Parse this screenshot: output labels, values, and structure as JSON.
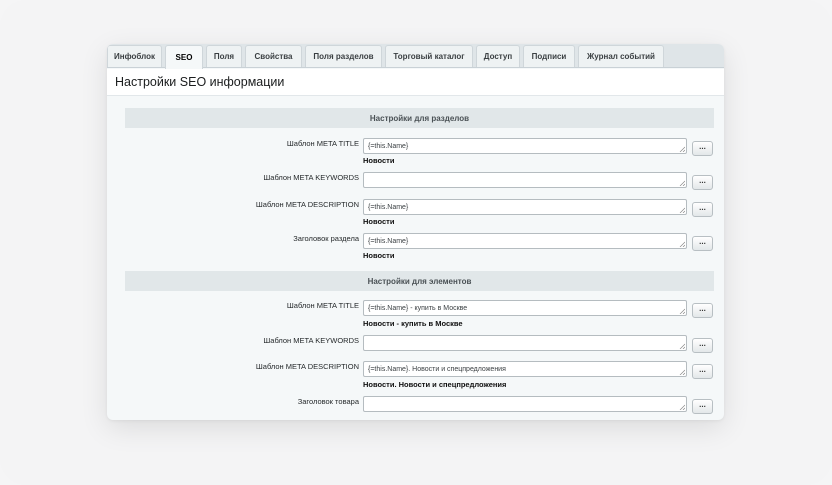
{
  "tabs": [
    {
      "label": "Инфоблок"
    },
    {
      "label": "SEO"
    },
    {
      "label": "Поля"
    },
    {
      "label": "Свойства"
    },
    {
      "label": "Поля разделов"
    },
    {
      "label": "Торговый каталог"
    },
    {
      "label": "Доступ"
    },
    {
      "label": "Подписи"
    },
    {
      "label": "Журнал событий"
    }
  ],
  "active_tab": "SEO",
  "page_title": "Настройки SEO информации",
  "sections": {
    "sections_settings": {
      "title": "Настройки для разделов",
      "rows": [
        {
          "label": "Шаблон META TITLE",
          "value": "{=this.Name}",
          "preview": "Новости"
        },
        {
          "label": "Шаблон META KEYWORDS",
          "value": "",
          "preview": ""
        },
        {
          "label": "Шаблон META DESCRIPTION",
          "value": "{=this.Name}",
          "preview": "Новости"
        },
        {
          "label": "Заголовок раздела",
          "value": "{=this.Name}",
          "preview": "Новости"
        }
      ]
    },
    "elements_settings": {
      "title": "Настройки для элементов",
      "rows": [
        {
          "label": "Шаблон META TITLE",
          "value": "{=this.Name} - купить в Москве",
          "preview": "Новости - купить в Москве"
        },
        {
          "label": "Шаблон META KEYWORDS",
          "value": "",
          "preview": ""
        },
        {
          "label": "Шаблон META DESCRIPTION",
          "value": "{=this.Name}. Новости и спецпредложения",
          "preview": "Новости. Новости и спецпредложения"
        },
        {
          "label": "Заголовок товара",
          "value": "",
          "preview": ""
        }
      ]
    }
  },
  "insert_button_label": "..."
}
